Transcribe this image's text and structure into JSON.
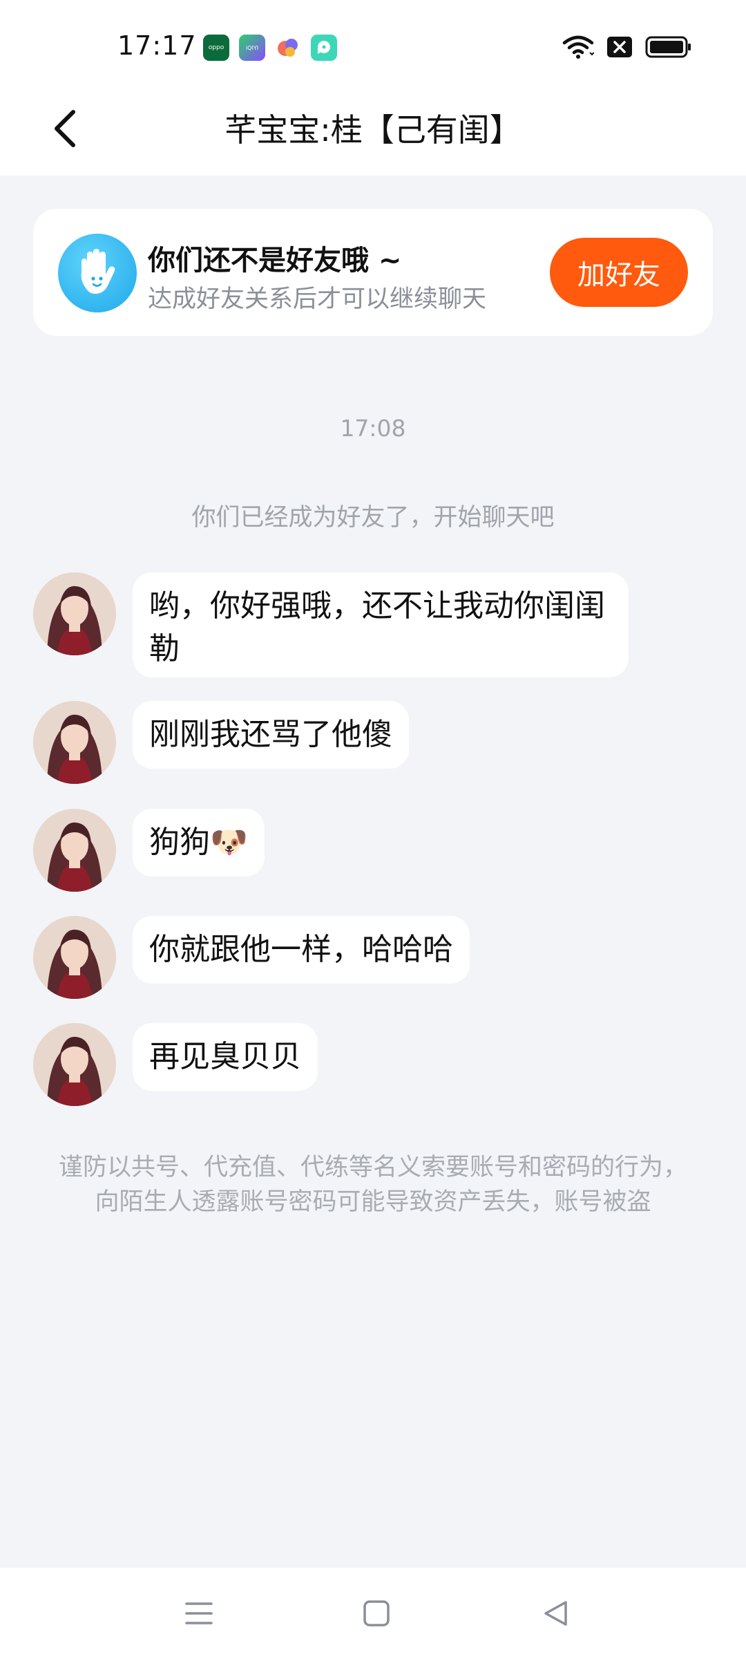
{
  "status_bar": {
    "time": "17:17",
    "app_icons": [
      "oppo-icon",
      "iqiyi-icon",
      "bubble-app-icon",
      "chat-app-icon"
    ],
    "oppo_label": "oppo",
    "iqiyi_label": "iQIYI"
  },
  "header": {
    "title": "芊宝宝:桂【己有闺】"
  },
  "friend_card": {
    "title": "你们还不是好友哦 ~",
    "subtitle": "达成好友关系后才可以继续聊天",
    "add_button_label": "加好友"
  },
  "chat": {
    "timestamp": "17:08",
    "system_message": "你们已经成为好友了，开始聊天吧",
    "messages": [
      {
        "text": "哟，你好强哦，还不让我动你闺闺勒"
      },
      {
        "text": "刚刚我还骂了他傻"
      },
      {
        "text": "狗狗🐶"
      },
      {
        "text": "你就跟他一样，哈哈哈"
      },
      {
        "text": "再见臭贝贝"
      }
    ]
  },
  "warning_text": "谨防以共号、代充值、代练等名义索要账号和密码的行为，向陌生人透露账号密码可能导致资产丢失，账号被盗",
  "nav_bar": {
    "icons": [
      "menu-icon",
      "home-icon",
      "back-triangle-icon"
    ]
  },
  "colors": {
    "accent": "#FF5A0D",
    "background": "#F2F4F7",
    "hint_text": "#A0A4AC"
  }
}
